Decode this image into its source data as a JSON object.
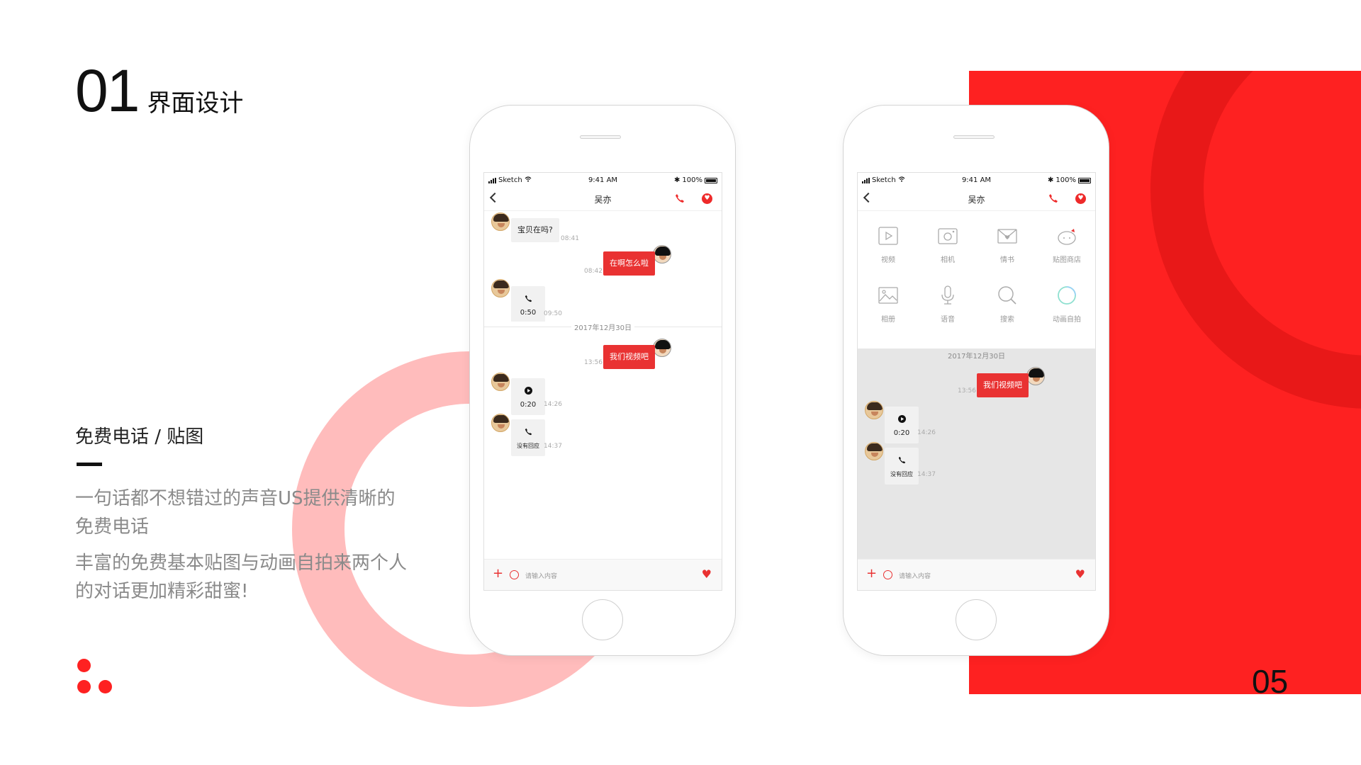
{
  "slide": {
    "number": "01",
    "title": "界面设计",
    "page_number": "05",
    "subtitle": "免费电话 / 贴图",
    "paragraph1": "一句话都不想错过的声音US提供清晰的免费电话",
    "paragraph2": "丰富的免费基本贴图与动画自拍来两个人的对话更加精彩甜蜜!"
  },
  "colors": {
    "accent": "#fe2121",
    "ring_dark": "#e81818",
    "ring_pink": "#ffbcbc",
    "bubble_red": "#e93232"
  },
  "status_bar": {
    "carrier": "Sketch",
    "time": "9:41 AM",
    "battery": "100%"
  },
  "chat": {
    "contact_name": "吴亦",
    "date_separator": "2017年12月30日",
    "input_placeholder": "请输入内容",
    "messages": [
      {
        "text": "宝贝在吗?",
        "time": "08:41"
      },
      {
        "text": "在啊怎么啦",
        "time": "08:42"
      },
      {
        "text": "0:50",
        "time": "09:50"
      },
      {
        "text": "我们视频吧",
        "time": "13:56"
      },
      {
        "text": "0:20",
        "time": "14:26"
      },
      {
        "text": "没有回应",
        "time": "14:37"
      }
    ]
  },
  "panel": {
    "items": [
      {
        "label": "视频",
        "icon": "video-icon"
      },
      {
        "label": "相机",
        "icon": "camera-icon"
      },
      {
        "label": "情书",
        "icon": "love-letter-icon"
      },
      {
        "label": "贴图商店",
        "icon": "sticker-store-icon"
      },
      {
        "label": "相册",
        "icon": "album-icon"
      },
      {
        "label": "语音",
        "icon": "microphone-icon"
      },
      {
        "label": "搜索",
        "icon": "search-icon"
      },
      {
        "label": "动画自拍",
        "icon": "animated-selfie-icon"
      }
    ]
  }
}
